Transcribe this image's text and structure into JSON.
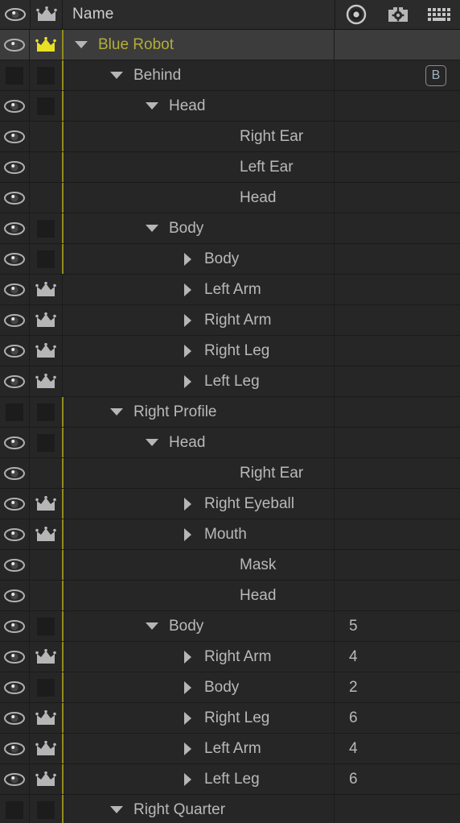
{
  "panel": {
    "title": "layers-panel",
    "colors": {
      "background": "#262626",
      "header_background": "#2b2b2b",
      "selected_row": "#3c3c3c",
      "selected_text": "#b3ae38",
      "text": "#b9b9b9",
      "crown_active": "#e8e024",
      "crown_inactive": "#b6b6b6",
      "tick_marker": "#918c1f",
      "row_divider": "#1b1b1b"
    }
  },
  "header": {
    "eye_icon": "eye-icon",
    "crown_icon": "crown-icon",
    "name_label": "Name",
    "icons": [
      {
        "name": "record-target-icon",
        "title": "record"
      },
      {
        "name": "camera-gear-icon",
        "title": "camera settings"
      },
      {
        "name": "keyboard-icon",
        "title": "keyboard triggers"
      }
    ]
  },
  "rows": [
    {
      "label": "Blue Robot",
      "indent": 0,
      "twirl": "down",
      "eye": "eye",
      "crown": "crown-yellow",
      "tick": true,
      "value": "",
      "badge": "",
      "selected": true
    },
    {
      "label": "Behind",
      "indent": 1,
      "twirl": "down",
      "eye": "square",
      "crown": "square",
      "tick": true,
      "value": "",
      "badge": "B",
      "selected": false
    },
    {
      "label": "Head",
      "indent": 2,
      "twirl": "down",
      "eye": "eye",
      "crown": "square",
      "tick": true,
      "value": "",
      "badge": "",
      "selected": false
    },
    {
      "label": "Right Ear",
      "indent": 4,
      "twirl": "none",
      "eye": "eye",
      "crown": "none",
      "tick": true,
      "value": "",
      "badge": "",
      "selected": false
    },
    {
      "label": "Left Ear",
      "indent": 4,
      "twirl": "none",
      "eye": "eye",
      "crown": "none",
      "tick": true,
      "value": "",
      "badge": "",
      "selected": false
    },
    {
      "label": "Head",
      "indent": 4,
      "twirl": "none",
      "eye": "eye",
      "crown": "none",
      "tick": true,
      "value": "",
      "badge": "",
      "selected": false
    },
    {
      "label": "Body",
      "indent": 2,
      "twirl": "down",
      "eye": "eye",
      "crown": "square",
      "tick": true,
      "value": "",
      "badge": "",
      "selected": false
    },
    {
      "label": "Body",
      "indent": 3,
      "twirl": "right",
      "eye": "eye",
      "crown": "square",
      "tick": true,
      "value": "",
      "badge": "",
      "selected": false
    },
    {
      "label": "Left Arm",
      "indent": 3,
      "twirl": "right",
      "eye": "eye",
      "crown": "crown-gray",
      "tick": false,
      "value": "",
      "badge": "",
      "selected": false
    },
    {
      "label": "Right Arm",
      "indent": 3,
      "twirl": "right",
      "eye": "eye",
      "crown": "crown-gray",
      "tick": false,
      "value": "",
      "badge": "",
      "selected": false
    },
    {
      "label": "Right Leg",
      "indent": 3,
      "twirl": "right",
      "eye": "eye",
      "crown": "crown-gray",
      "tick": false,
      "value": "",
      "badge": "",
      "selected": false
    },
    {
      "label": "Left Leg",
      "indent": 3,
      "twirl": "right",
      "eye": "eye",
      "crown": "crown-gray",
      "tick": false,
      "value": "",
      "badge": "",
      "selected": false
    },
    {
      "label": "Right Profile",
      "indent": 1,
      "twirl": "down",
      "eye": "square",
      "crown": "square",
      "tick": true,
      "value": "",
      "badge": "",
      "selected": false
    },
    {
      "label": "Head",
      "indent": 2,
      "twirl": "down",
      "eye": "eye",
      "crown": "square",
      "tick": true,
      "value": "",
      "badge": "",
      "selected": false
    },
    {
      "label": "Right Ear",
      "indent": 4,
      "twirl": "none",
      "eye": "eye",
      "crown": "none",
      "tick": true,
      "value": "",
      "badge": "",
      "selected": false
    },
    {
      "label": "Right Eyeball",
      "indent": 3,
      "twirl": "right",
      "eye": "eye",
      "crown": "crown-gray",
      "tick": true,
      "value": "",
      "badge": "",
      "selected": false
    },
    {
      "label": "Mouth",
      "indent": 3,
      "twirl": "right",
      "eye": "eye",
      "crown": "crown-gray",
      "tick": true,
      "value": "",
      "badge": "",
      "selected": false
    },
    {
      "label": "Mask",
      "indent": 4,
      "twirl": "none",
      "eye": "eye",
      "crown": "none",
      "tick": true,
      "value": "",
      "badge": "",
      "selected": false
    },
    {
      "label": "Head",
      "indent": 4,
      "twirl": "none",
      "eye": "eye",
      "crown": "none",
      "tick": true,
      "value": "",
      "badge": "",
      "selected": false
    },
    {
      "label": "Body",
      "indent": 2,
      "twirl": "down",
      "eye": "eye",
      "crown": "square",
      "tick": true,
      "value": "5",
      "badge": "",
      "selected": false
    },
    {
      "label": "Right Arm",
      "indent": 3,
      "twirl": "right",
      "eye": "eye",
      "crown": "crown-gray",
      "tick": true,
      "value": "4",
      "badge": "",
      "selected": false
    },
    {
      "label": "Body",
      "indent": 3,
      "twirl": "right",
      "eye": "eye",
      "crown": "square",
      "tick": true,
      "value": "2",
      "badge": "",
      "selected": false
    },
    {
      "label": "Right Leg",
      "indent": 3,
      "twirl": "right",
      "eye": "eye",
      "crown": "crown-gray",
      "tick": true,
      "value": "6",
      "badge": "",
      "selected": false
    },
    {
      "label": "Left Arm",
      "indent": 3,
      "twirl": "right",
      "eye": "eye",
      "crown": "crown-gray",
      "tick": true,
      "value": "4",
      "badge": "",
      "selected": false
    },
    {
      "label": "Left Leg",
      "indent": 3,
      "twirl": "right",
      "eye": "eye",
      "crown": "crown-gray",
      "tick": true,
      "value": "6",
      "badge": "",
      "selected": false
    },
    {
      "label": "Right Quarter",
      "indent": 1,
      "twirl": "down",
      "eye": "square",
      "crown": "square",
      "tick": true,
      "value": "",
      "badge": "",
      "selected": false
    }
  ]
}
